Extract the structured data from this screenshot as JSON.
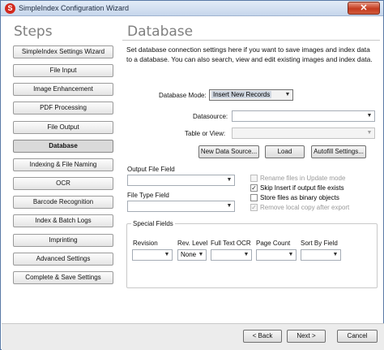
{
  "window": {
    "title": "SimpleIndex Configuration Wizard",
    "app_icon": "S",
    "close_glyph": "✕"
  },
  "steps": {
    "heading": "Steps",
    "items": [
      {
        "label": "SimpleIndex Settings Wizard",
        "active": false
      },
      {
        "label": "File Input",
        "active": false
      },
      {
        "label": "Image Enhancement",
        "active": false
      },
      {
        "label": "PDF Processing",
        "active": false
      },
      {
        "label": "File Output",
        "active": false
      },
      {
        "label": "Database",
        "active": true
      },
      {
        "label": "Indexing & File Naming",
        "active": false
      },
      {
        "label": "OCR",
        "active": false
      },
      {
        "label": "Barcode Recognition",
        "active": false
      },
      {
        "label": "Index & Batch Logs",
        "active": false
      },
      {
        "label": "Imprinting",
        "active": false
      },
      {
        "label": "Advanced Settings",
        "active": false
      },
      {
        "label": "Complete & Save Settings",
        "active": false
      }
    ]
  },
  "database": {
    "heading": "Database",
    "description": "Set database connection settings here if you want to save images and index data to a database. You can also search, view and edit existing images and index data.",
    "mode_label": "Database Mode:",
    "mode_value": "Insert New Records",
    "datasource_label": "Datasource:",
    "datasource_value": "",
    "table_label": "Table or View:",
    "table_value": "",
    "buttons": {
      "new_datasource": "New Data Source...",
      "load": "Load",
      "autofill": "Autofill Settings..."
    },
    "output_file_field_label": "Output File Field",
    "output_file_field_value": "",
    "file_type_field_label": "File Type Field",
    "file_type_field_value": "",
    "options": {
      "rename_files": {
        "label": "Rename files in Update mode",
        "checked": false,
        "enabled": false
      },
      "skip_insert": {
        "label": "Skip Insert if output file exists",
        "checked": true,
        "enabled": true
      },
      "store_binary": {
        "label": "Store files as binary objects",
        "checked": false,
        "enabled": true
      },
      "remove_local": {
        "label": "Remove local copy after export",
        "checked": true,
        "enabled": false
      }
    },
    "special_fields": {
      "title": "Special Fields",
      "revision": {
        "label": "Revision",
        "value": ""
      },
      "rev_level": {
        "label": "Rev. Level",
        "value": "None"
      },
      "full_text_ocr": {
        "label": "Full Text OCR",
        "value": ""
      },
      "page_count": {
        "label": "Page Count",
        "value": ""
      },
      "sort_by_field": {
        "label": "Sort By Field",
        "value": ""
      }
    }
  },
  "nav": {
    "back": "< Back",
    "next": "Next >",
    "cancel": "Cancel"
  },
  "icons": {
    "dropdown": "chevron-down-icon",
    "check": "checkmark-icon"
  },
  "colors": {
    "title_bar": "#c6d6ec",
    "close_button": "#c43b1f",
    "heading_gray": "#7f7f7f",
    "selection": "#cfd6e0"
  }
}
